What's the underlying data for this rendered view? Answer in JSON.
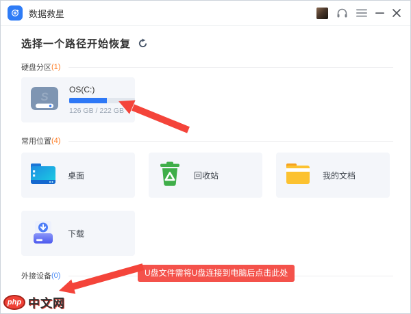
{
  "titlebar": {
    "app_title": "数据救星"
  },
  "icons": {
    "app_logo": "circle-arrow-plus-recovery",
    "user": "avatar-photo",
    "support": "headset",
    "menu": "hamburger-three-lines",
    "minimize": "minus-line",
    "close": "x-cross",
    "refresh": "circular-arrow",
    "hard_drive": "hdd-with-s",
    "desktop": "blue-cyan-folder",
    "recycle_bin": "green-trash-recycle",
    "documents": "yellow-folder",
    "downloads": "indigo-tray-download-cloud"
  },
  "header": {
    "title": "选择一个路径开始恢复"
  },
  "sections": {
    "hard_disk": {
      "label": "硬盘分区",
      "count": "(1)",
      "count_style": "color:#ff7e26"
    },
    "common": {
      "label": "常用位置",
      "count": "(4)",
      "count_style": "color:#ff7e26"
    },
    "external": {
      "label": "外接设备",
      "count": "(0)",
      "count_style": "color:#4d8df6"
    }
  },
  "disk": {
    "name": "OS(C:)",
    "used_gb": 126,
    "total_gb": 222,
    "usage": "126 GB / 222 GB",
    "bar_width_style": "width:56.8%"
  },
  "locations": {
    "desktop": {
      "label": "桌面"
    },
    "recycle": {
      "label": "回收站"
    },
    "documents": {
      "label": "我的文档"
    },
    "downloads": {
      "label": "下载"
    }
  },
  "annotation": {
    "tooltip_text": "U盘文件需将U盘连接到电脑后点击此处"
  },
  "watermark": {
    "badge": "php",
    "text": "中文网"
  },
  "colors": {
    "accent_blue": "#2e78f6",
    "card_bg": "#f4f6fa",
    "arrow_red": "#f4443a",
    "tooltip_red": "#f4524b",
    "count_orange": "#ff7e26",
    "count_blue": "#4d8df6"
  }
}
